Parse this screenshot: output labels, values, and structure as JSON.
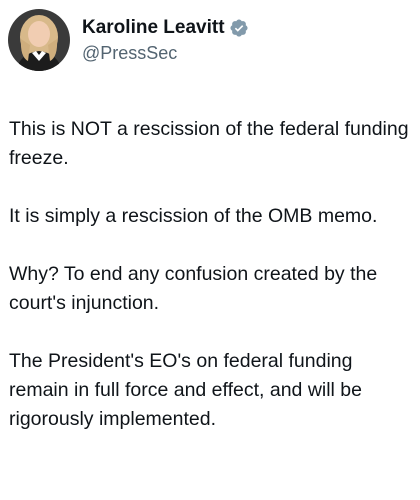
{
  "author": {
    "display_name": "Karoline Leavitt",
    "handle": "@PressSec",
    "verified_icon": "verified-badge-icon",
    "verified_color": "#829aab",
    "avatar_icon": "profile-photo"
  },
  "tweet": {
    "paragraphs": [
      "This is NOT a rescission of the federal funding freeze.",
      "It is simply a rescission of the OMB memo.",
      "Why? To end any confusion created by the court's injunction.",
      "The President's EO's on federal funding remain in full force and effect, and will be rigorously implemented."
    ]
  },
  "colors": {
    "text": "#0f1419",
    "secondary_text": "#536471",
    "background": "#ffffff"
  }
}
